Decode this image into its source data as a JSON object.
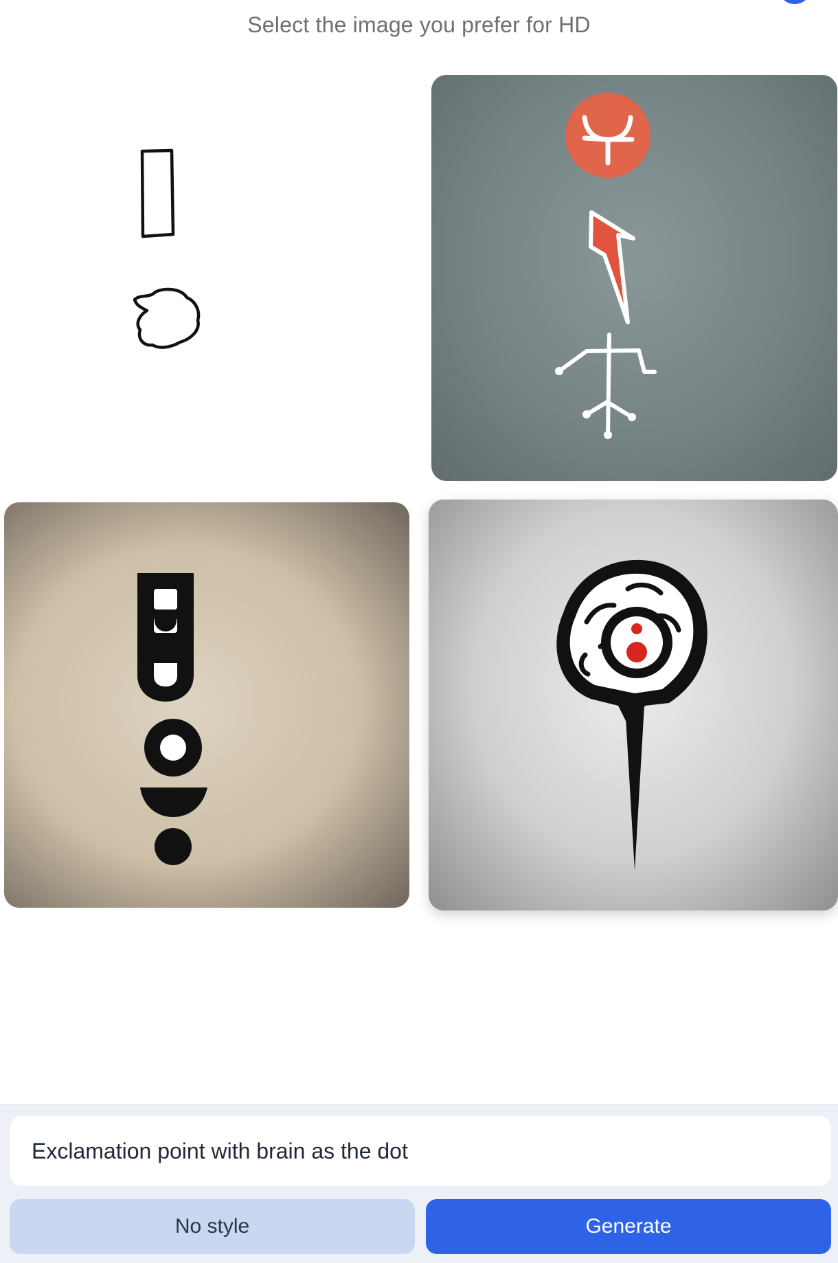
{
  "header": {
    "instruction": "Select the image you prefer for HD"
  },
  "images": [
    {
      "name": "sketch-input",
      "description_icon": "exclamation-sketch"
    },
    {
      "name": "option-stick-figure",
      "description_icon": "stick-figure-arrow"
    },
    {
      "name": "option-stacked-exclamation",
      "description_icon": "exclamation-symbol"
    },
    {
      "name": "option-brain-exclamation",
      "description_icon": "brain-exclamation"
    }
  ],
  "prompt": {
    "value": "Exclamation point with brain as the dot"
  },
  "buttons": {
    "style_label": "No style",
    "generate_label": "Generate"
  },
  "colors": {
    "accent": "#2e63e8",
    "secondary_button": "#c9d7f1",
    "panel_bg": "#eef0f7",
    "header_text": "#6f6f74"
  }
}
